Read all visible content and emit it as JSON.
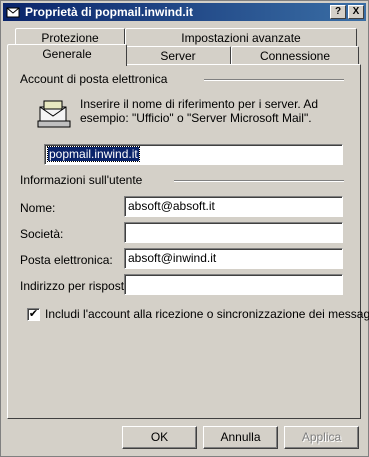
{
  "window": {
    "title": "Proprietà di popmail.inwind.it",
    "help_button": "?",
    "close_button": "X"
  },
  "tabs": {
    "row_back": [
      "Protezione",
      "Impostazioni avanzate"
    ],
    "row_front": [
      "Generale",
      "Server",
      "Connessione"
    ],
    "active": "Generale"
  },
  "mail_account": {
    "group_label": "Account di posta elettronica",
    "description": "Inserire il nome di riferimento per i server. Ad esempio: \"Ufficio\" o \"Server Microsoft Mail\".",
    "account_name": "popmail.inwind.it",
    "icon": "mail-envelope-icon"
  },
  "user_info": {
    "group_label": "Informazioni sull'utente",
    "name_label": "Nome:",
    "name_value": "absoft@absoft.it",
    "company_label": "Società:",
    "company_value": "",
    "email_label": "Posta elettronica:",
    "email_value": "absoft@inwind.it",
    "reply_label": "Indirizzo per risposte:",
    "reply_value": ""
  },
  "include_account": {
    "checked": true,
    "label": "Includi l'account alla ricezione o sincronizzazione dei messaggi"
  },
  "buttons": {
    "ok": "OK",
    "cancel": "Annulla",
    "apply": "Applica"
  }
}
